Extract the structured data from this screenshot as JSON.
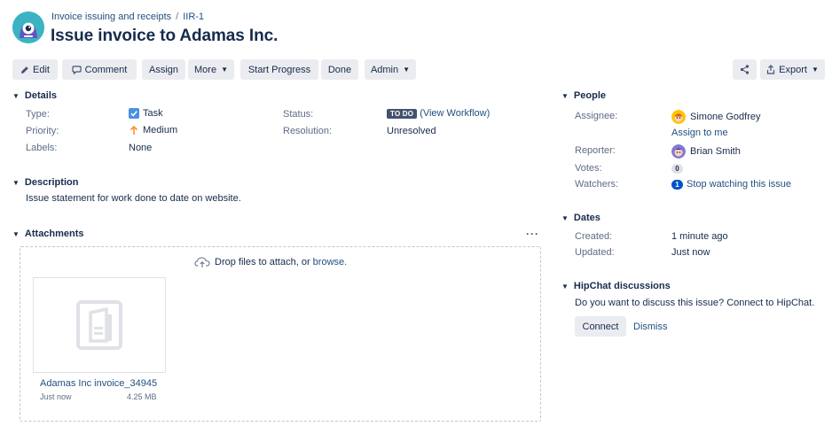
{
  "breadcrumb": {
    "project": "Invoice issuing and receipts",
    "separator": "/",
    "issue_key": "IIR-1"
  },
  "issue": {
    "title": "Issue invoice to Adamas Inc."
  },
  "toolbar": {
    "edit": "Edit",
    "comment": "Comment",
    "assign": "Assign",
    "more": "More",
    "start_progress": "Start Progress",
    "done": "Done",
    "admin": "Admin",
    "export": "Export"
  },
  "details": {
    "heading": "Details",
    "type_label": "Type:",
    "type_value": "Task",
    "priority_label": "Priority:",
    "priority_value": "Medium",
    "labels_label": "Labels:",
    "labels_value": "None",
    "status_label": "Status:",
    "status_value": "TO DO",
    "view_workflow": "(View Workflow)",
    "resolution_label": "Resolution:",
    "resolution_value": "Unresolved"
  },
  "description": {
    "heading": "Description",
    "text": "Issue statement for work done to date on website."
  },
  "attachments": {
    "heading": "Attachments",
    "more_icon": "ellipsis-icon",
    "drop_text": "Drop files to attach, or",
    "browse": "browse.",
    "file": {
      "name": "Adamas Inc invoice_34945",
      "date": "Just now",
      "size": "4.25 MB"
    }
  },
  "people": {
    "heading": "People",
    "assignee_label": "Assignee:",
    "assignee": "Simone Godfrey",
    "assign_to_me": "Assign to me",
    "reporter_label": "Reporter:",
    "reporter": "Brian Smith",
    "votes_label": "Votes:",
    "votes": "0",
    "watchers_label": "Watchers:",
    "watchers": "1",
    "stop_watching": "Stop watching this issue"
  },
  "dates": {
    "heading": "Dates",
    "created_label": "Created:",
    "created": "1 minute ago",
    "updated_label": "Updated:",
    "updated": "Just now"
  },
  "hipchat": {
    "heading": "HipChat discussions",
    "text": "Do you want to discuss this issue? Connect to HipChat.",
    "connect": "Connect",
    "dismiss": "Dismiss"
  },
  "colors": {
    "link": "#205081",
    "button_bg": "#ebecf0",
    "status_lozenge": "#42526e",
    "checkbox": "#4a90e2",
    "priority": "#f79232",
    "avatar": "#3bb3c3"
  }
}
